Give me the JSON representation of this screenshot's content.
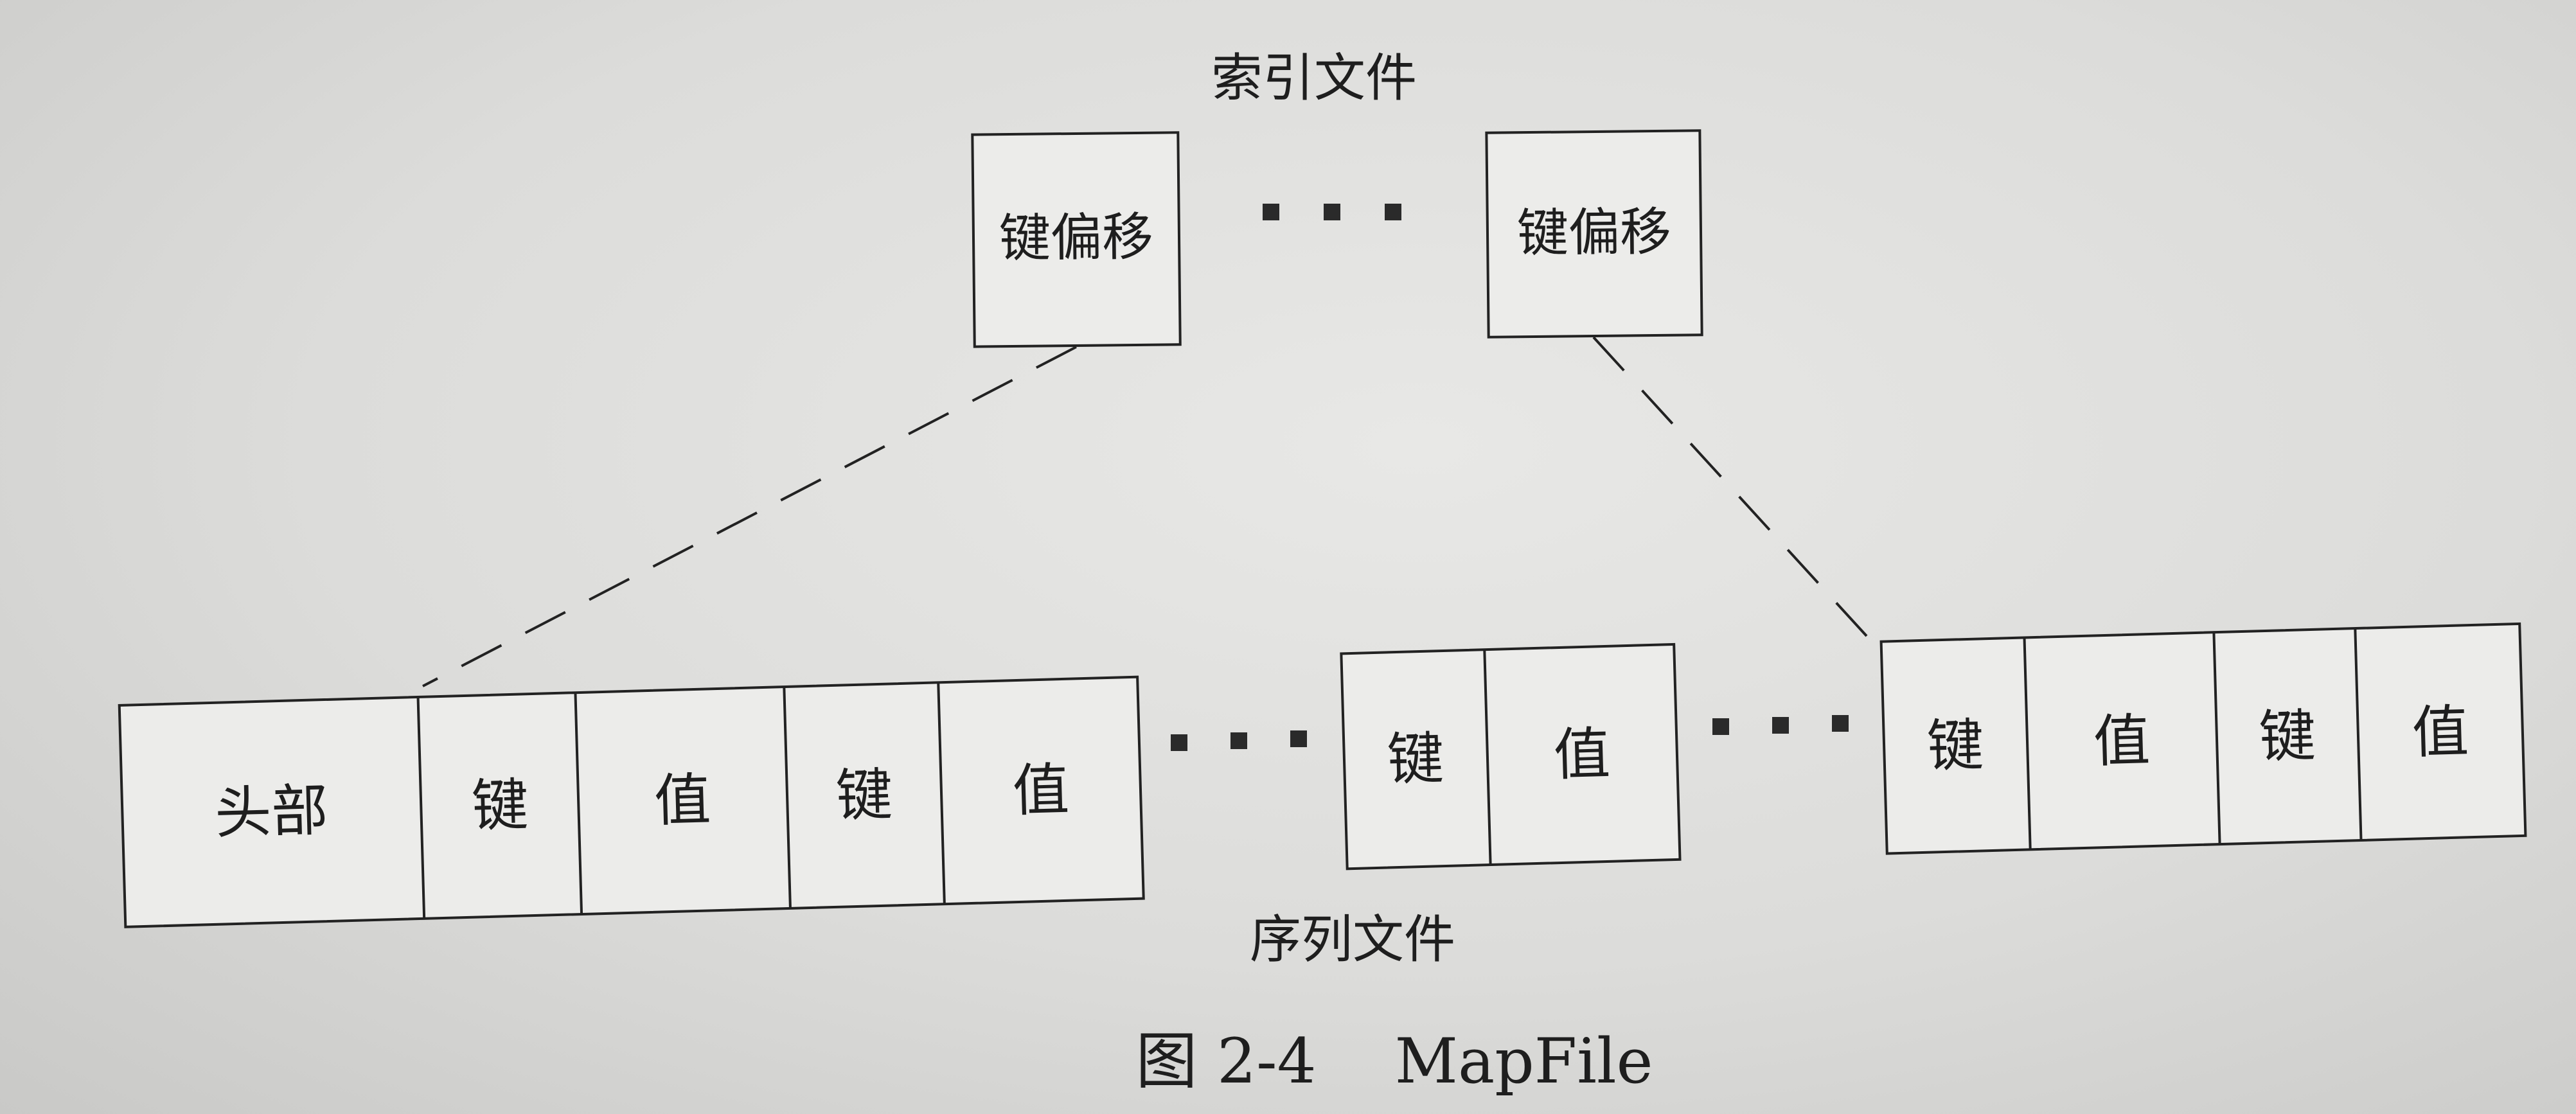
{
  "index_file": {
    "label": "索引文件",
    "entries": [
      {
        "label": "键偏移"
      },
      {
        "label": "键偏移"
      }
    ]
  },
  "sequence_file": {
    "label": "序列文件",
    "groups": [
      {
        "cells": [
          "头部",
          "键",
          "值",
          "键",
          "值"
        ]
      },
      {
        "cells": [
          "键",
          "值"
        ]
      },
      {
        "cells": [
          "键",
          "值",
          "键",
          "值"
        ]
      }
    ]
  },
  "caption": {
    "figure": "图 2-4",
    "name": "MapFile"
  }
}
